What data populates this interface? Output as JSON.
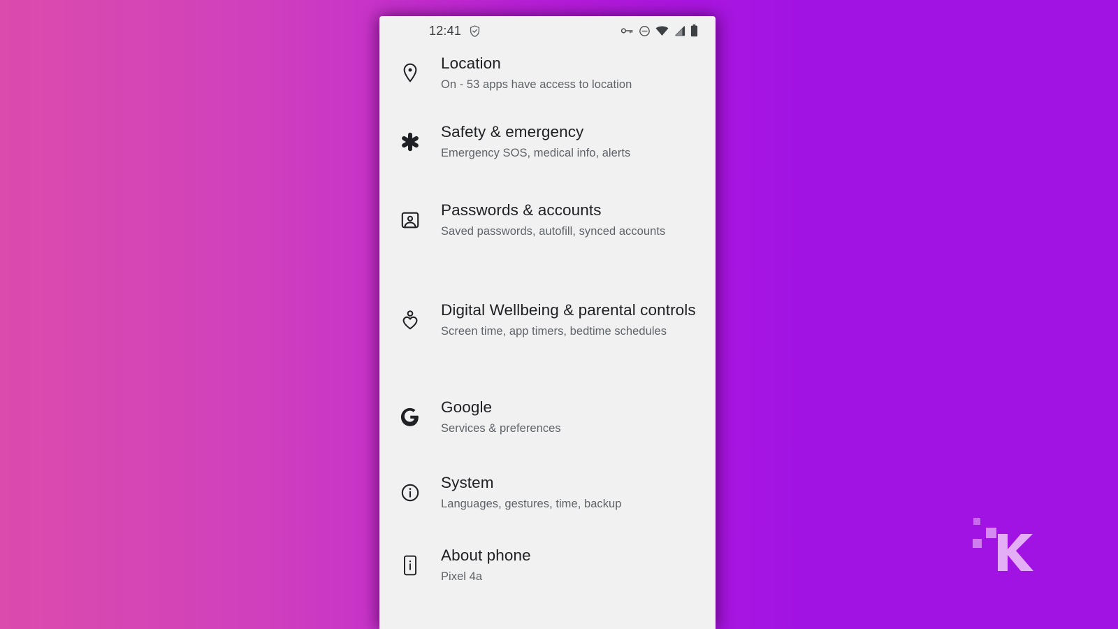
{
  "background": {
    "gradient_from": "#DB4BAD",
    "gradient_to": "#A113E3"
  },
  "phone": {
    "card_background": "#F1F1F2",
    "status_bar": {
      "clock": "12:41",
      "left_icons": [
        "shield-check-icon"
      ],
      "right_icons": [
        "vpn-key-icon",
        "do-not-disturb-icon",
        "wifi-icon",
        "signal-cellular-icon",
        "battery-icon"
      ]
    },
    "settings": {
      "items": [
        {
          "id": "location",
          "icon": "location-pin-icon",
          "title": "Location",
          "subtitle": "On - 53 apps have access to location"
        },
        {
          "id": "safety",
          "icon": "emergency-asterisk-icon",
          "title": "Safety & emergency",
          "subtitle": "Emergency SOS, medical info, alerts"
        },
        {
          "id": "passwords",
          "icon": "account-box-icon",
          "title": "Passwords & accounts",
          "subtitle": "Saved passwords, autofill, synced accounts"
        },
        {
          "id": "wellbeing",
          "icon": "person-heart-icon",
          "title": "Digital Wellbeing & parental controls",
          "subtitle": "Screen time, app timers, bedtime schedules"
        },
        {
          "id": "google",
          "icon": "google-g-icon",
          "title": "Google",
          "subtitle": "Services & preferences"
        },
        {
          "id": "system",
          "icon": "info-circle-icon",
          "title": "System",
          "subtitle": "Languages, gestures, time, backup"
        },
        {
          "id": "about",
          "icon": "phone-info-icon",
          "title": "About phone",
          "subtitle": "Pixel 4a"
        }
      ]
    }
  },
  "watermark": {
    "letter": "K",
    "color": "#E7B6F5"
  }
}
